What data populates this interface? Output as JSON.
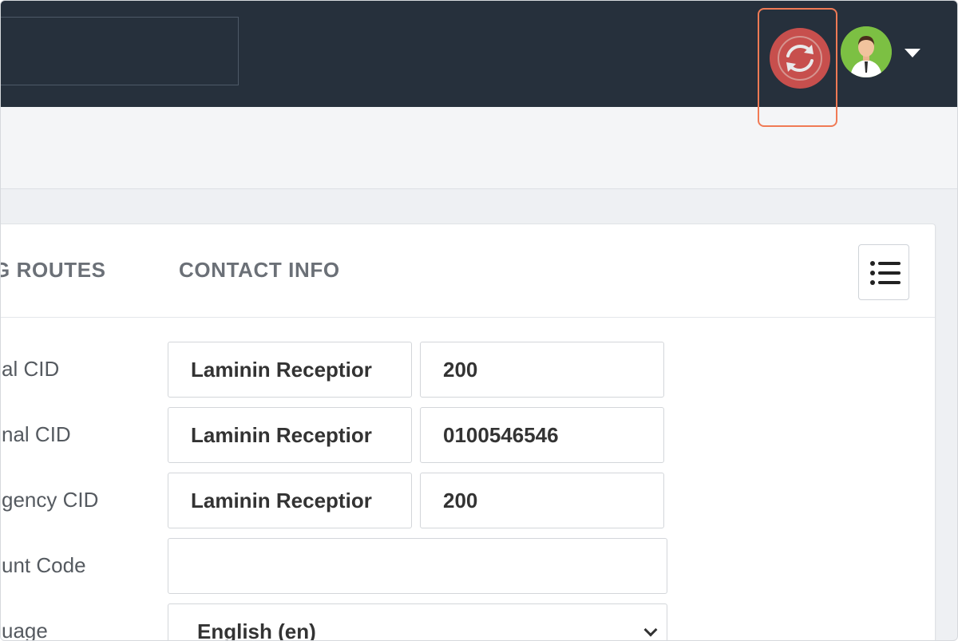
{
  "header": {
    "search": {
      "value": "",
      "placeholder": ""
    },
    "sync_icon": "sync-icon",
    "avatar_icon": "user-avatar",
    "accent_color": "#d9534f",
    "highlight_color": "#f07a55"
  },
  "tabs": [
    {
      "label": "G ROUTES"
    },
    {
      "label": "CONTACT INFO"
    }
  ],
  "form": {
    "rows": [
      {
        "label": "al CID",
        "name_value": "Laminin Receptior",
        "number_value": "200"
      },
      {
        "label": "nal CID",
        "name_value": "Laminin Receptior",
        "number_value": "0100546546"
      },
      {
        "label": "gency CID",
        "name_value": "Laminin Receptior",
        "number_value": "200"
      }
    ],
    "account_code": {
      "label": "unt Code",
      "value": ""
    },
    "language": {
      "label": "uage",
      "value": "English (en)"
    }
  }
}
